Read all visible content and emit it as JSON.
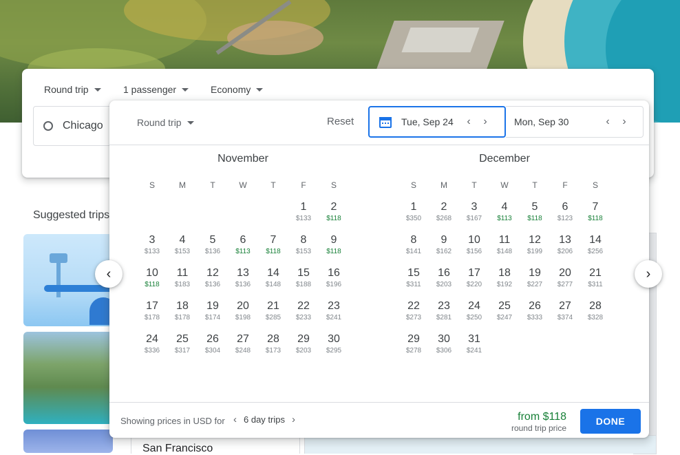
{
  "search": {
    "trip_type": "Round trip",
    "passengers": "1 passenger",
    "cabin": "Economy",
    "origin": "Chicago"
  },
  "suggested": {
    "title": "Suggested trips",
    "card_city": "San Francisco"
  },
  "picker": {
    "trip_type": "Round trip",
    "reset": "Reset",
    "depart": "Tue, Sep 24",
    "return": "Mon, Sep 30",
    "weekdays": [
      "S",
      "M",
      "T",
      "W",
      "T",
      "F",
      "S"
    ],
    "months": [
      {
        "name": "November",
        "offset": 5,
        "days": [
          {
            "d": "1",
            "p": "$133"
          },
          {
            "d": "2",
            "p": "$118",
            "low": true
          },
          {
            "d": "3",
            "p": "$133"
          },
          {
            "d": "4",
            "p": "$153"
          },
          {
            "d": "5",
            "p": "$136"
          },
          {
            "d": "6",
            "p": "$113",
            "low": true
          },
          {
            "d": "7",
            "p": "$118",
            "low": true
          },
          {
            "d": "8",
            "p": "$153"
          },
          {
            "d": "9",
            "p": "$118",
            "low": true
          },
          {
            "d": "10",
            "p": "$118",
            "low": true
          },
          {
            "d": "11",
            "p": "$183"
          },
          {
            "d": "12",
            "p": "$136"
          },
          {
            "d": "13",
            "p": "$136"
          },
          {
            "d": "14",
            "p": "$148"
          },
          {
            "d": "15",
            "p": "$188"
          },
          {
            "d": "16",
            "p": "$196"
          },
          {
            "d": "17",
            "p": "$178"
          },
          {
            "d": "18",
            "p": "$178"
          },
          {
            "d": "19",
            "p": "$174"
          },
          {
            "d": "20",
            "p": "$198"
          },
          {
            "d": "21",
            "p": "$285"
          },
          {
            "d": "22",
            "p": "$233"
          },
          {
            "d": "23",
            "p": "$241"
          },
          {
            "d": "24",
            "p": "$336"
          },
          {
            "d": "25",
            "p": "$317"
          },
          {
            "d": "26",
            "p": "$304"
          },
          {
            "d": "27",
            "p": "$248"
          },
          {
            "d": "28",
            "p": "$173"
          },
          {
            "d": "29",
            "p": "$203"
          },
          {
            "d": "30",
            "p": "$295"
          }
        ]
      },
      {
        "name": "December",
        "offset": 0,
        "days": [
          {
            "d": "1",
            "p": "$350"
          },
          {
            "d": "2",
            "p": "$268"
          },
          {
            "d": "3",
            "p": "$167"
          },
          {
            "d": "4",
            "p": "$113",
            "low": true
          },
          {
            "d": "5",
            "p": "$118",
            "low": true
          },
          {
            "d": "6",
            "p": "$123"
          },
          {
            "d": "7",
            "p": "$118",
            "low": true
          },
          {
            "d": "8",
            "p": "$141"
          },
          {
            "d": "9",
            "p": "$162"
          },
          {
            "d": "10",
            "p": "$156"
          },
          {
            "d": "11",
            "p": "$148"
          },
          {
            "d": "12",
            "p": "$199"
          },
          {
            "d": "13",
            "p": "$206"
          },
          {
            "d": "14",
            "p": "$256"
          },
          {
            "d": "15",
            "p": "$311"
          },
          {
            "d": "16",
            "p": "$203"
          },
          {
            "d": "17",
            "p": "$220"
          },
          {
            "d": "18",
            "p": "$192"
          },
          {
            "d": "19",
            "p": "$227"
          },
          {
            "d": "20",
            "p": "$277"
          },
          {
            "d": "21",
            "p": "$311"
          },
          {
            "d": "22",
            "p": "$273"
          },
          {
            "d": "23",
            "p": "$281"
          },
          {
            "d": "24",
            "p": "$250"
          },
          {
            "d": "25",
            "p": "$247"
          },
          {
            "d": "26",
            "p": "$333"
          },
          {
            "d": "27",
            "p": "$374"
          },
          {
            "d": "28",
            "p": "$328"
          },
          {
            "d": "29",
            "p": "$278"
          },
          {
            "d": "30",
            "p": "$306"
          },
          {
            "d": "31",
            "p": "$241"
          }
        ]
      }
    ],
    "footer": {
      "showing": "Showing prices in USD for",
      "trip_length": "6 day trips",
      "from_price": "from $118",
      "price_note": "round trip price",
      "done": "DONE"
    }
  },
  "colors": {
    "accent": "#1a73e8",
    "low_price": "#188038"
  }
}
